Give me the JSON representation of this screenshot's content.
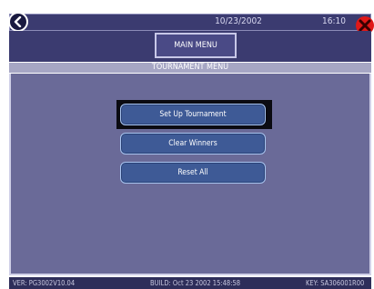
{
  "header": {
    "date": "10/23/2002",
    "time": "16:10",
    "main_menu_label": "MAIN MENU"
  },
  "screen": {
    "title": "TOURNAMENT MENU"
  },
  "menu": {
    "items": [
      {
        "label": "Set Up Tournament",
        "selected": true
      },
      {
        "label": "Clear Winners"
      },
      {
        "label": "Reset All"
      }
    ]
  },
  "status": {
    "ver": "VER: PG3002V10.04",
    "build": "BUILD: Oct 23 2002 15:48:58",
    "key": "KEY: SA306001R00"
  },
  "colors": {
    "panel": "#6a6a98",
    "header": "#3b3b70",
    "button": "#3e5a96",
    "close": "#e01818"
  },
  "icons": {
    "back": "back-arrow-icon",
    "close": "close-x-icon"
  }
}
